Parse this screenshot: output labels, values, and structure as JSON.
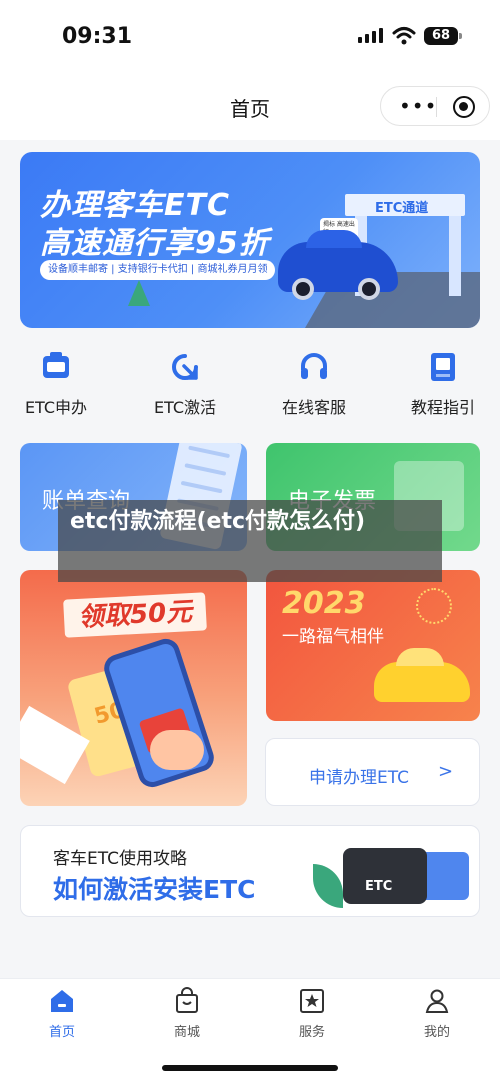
{
  "status": {
    "time": "09:31",
    "battery": "68"
  },
  "nav": {
    "title": "首页"
  },
  "banner": {
    "line1": "办理客车ETC",
    "line2": "高速通行享95折",
    "tags": "设备顺丰邮寄 | 支持银行卡代扣 | 商城礼券月月领",
    "gantry_label": "ETC通道",
    "bubble": "揭标\n高速出行"
  },
  "quick_menu": [
    {
      "label": "ETC申办",
      "icon": "etc-device-icon"
    },
    {
      "label": "ETC激活",
      "icon": "activate-arrow-icon"
    },
    {
      "label": "在线客服",
      "icon": "headset-icon"
    },
    {
      "label": "教程指引",
      "icon": "book-icon"
    }
  ],
  "cards": {
    "bill": "账单查询",
    "invoice": "电子发票",
    "promo": "领取50元",
    "coupon_value": "50",
    "year": "2023",
    "fortune": "一路福气相伴",
    "apply": "申请办理ETC",
    "apply_arrow": ">",
    "guide_sub": "客车ETC使用攻略",
    "guide_main": "如何激活安装ETC",
    "etc_card_label": "ETC"
  },
  "overlay": {
    "text": "etc付款流程(etc付款怎么付)"
  },
  "tabbar": [
    {
      "label": "首页",
      "icon": "home-icon",
      "active": true
    },
    {
      "label": "商城",
      "icon": "shopping-bag-icon",
      "active": false
    },
    {
      "label": "服务",
      "icon": "star-box-icon",
      "active": false
    },
    {
      "label": "我的",
      "icon": "profile-icon",
      "active": false
    }
  ],
  "colors": {
    "accent": "#2f6de8",
    "promo": "#f46b4b",
    "invoice": "#3fc46d"
  }
}
